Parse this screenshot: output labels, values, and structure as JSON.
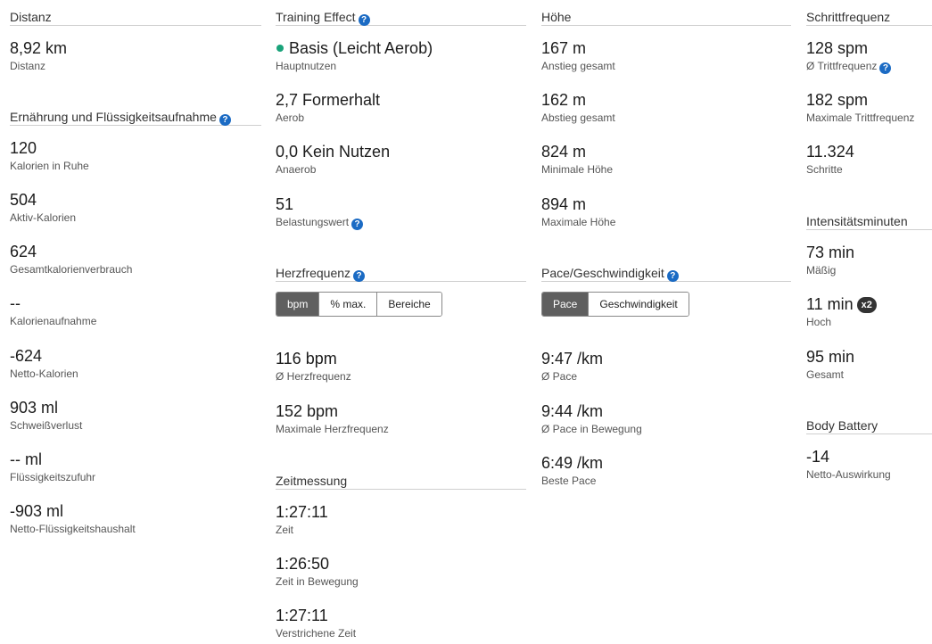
{
  "distanz": {
    "title": "Distanz",
    "stats": [
      {
        "value": "8,92 km",
        "label": "Distanz"
      }
    ]
  },
  "ernaehrung": {
    "title": "Ernährung und Flüssigkeitsaufnahme",
    "stats": [
      {
        "value": "120",
        "label": "Kalorien in Ruhe"
      },
      {
        "value": "504",
        "label": "Aktiv-Kalorien"
      },
      {
        "value": "624",
        "label": "Gesamtkalorienverbrauch"
      },
      {
        "value": "--",
        "label": "Kalorienaufnahme"
      },
      {
        "value": "-624",
        "label": "Netto-Kalorien"
      },
      {
        "value": "903 ml",
        "label": "Schweißverlust"
      },
      {
        "value": "-- ml",
        "label": "Flüssigkeitszufuhr"
      },
      {
        "value": "-903 ml",
        "label": "Netto-Flüssigkeitshaushalt"
      }
    ]
  },
  "training": {
    "title": "Training Effect",
    "stats": [
      {
        "value": "Basis (Leicht Aerob)",
        "label": "Hauptnutzen"
      },
      {
        "value": "2,7 Formerhalt",
        "label": "Aerob"
      },
      {
        "value": "0,0 Kein Nutzen",
        "label": "Anaerob"
      },
      {
        "value": "51",
        "label": "Belastungswert"
      }
    ]
  },
  "herzfrequenz": {
    "title": "Herzfrequenz",
    "tabs": [
      "bpm",
      "% max.",
      "Bereiche"
    ],
    "active_tab": "bpm",
    "stats": [
      {
        "value": "116 bpm",
        "label": "Ø Herzfrequenz"
      },
      {
        "value": "152 bpm",
        "label": "Maximale Herzfrequenz"
      }
    ]
  },
  "zeitmessung": {
    "title": "Zeitmessung",
    "stats": [
      {
        "value": "1:27:11",
        "label": "Zeit"
      },
      {
        "value": "1:26:50",
        "label": "Zeit in Bewegung"
      },
      {
        "value": "1:27:11",
        "label": "Verstrichene Zeit"
      }
    ]
  },
  "hoehe": {
    "title": "Höhe",
    "stats": [
      {
        "value": "167 m",
        "label": "Anstieg gesamt"
      },
      {
        "value": "162 m",
        "label": "Abstieg gesamt"
      },
      {
        "value": "824 m",
        "label": "Minimale Höhe"
      },
      {
        "value": "894 m",
        "label": "Maximale Höhe"
      }
    ]
  },
  "pace": {
    "title": "Pace/Geschwindigkeit",
    "tabs": [
      "Pace",
      "Geschwindigkeit"
    ],
    "active_tab": "Pace",
    "stats": [
      {
        "value": "9:47 /km",
        "label": "Ø Pace"
      },
      {
        "value": "9:44 /km",
        "label": "Ø Pace in Bewegung"
      },
      {
        "value": "6:49 /km",
        "label": "Beste Pace"
      }
    ]
  },
  "schrittfrequenz": {
    "title": "Schrittfrequenz",
    "stats": [
      {
        "value": "128 spm",
        "label": "Ø Trittfrequenz"
      },
      {
        "value": "182 spm",
        "label": "Maximale Trittfrequenz"
      },
      {
        "value": "11.324",
        "label": "Schritte"
      }
    ]
  },
  "intensitaet": {
    "title": "Intensitätsminuten",
    "badge": "x2",
    "stats": [
      {
        "value": "73 min",
        "label": "Mäßig"
      },
      {
        "value": "11 min",
        "label": "Hoch"
      },
      {
        "value": "95 min",
        "label": "Gesamt"
      }
    ]
  },
  "body_battery": {
    "title": "Body Battery",
    "stats": [
      {
        "value": "-14",
        "label": "Netto-Auswirkung"
      }
    ]
  },
  "help_icon_glyph": "?",
  "colors": {
    "accent_dot": "#1aa37a",
    "help_icon": "#1b6bc4",
    "active_tab": "#5f5f5f"
  }
}
